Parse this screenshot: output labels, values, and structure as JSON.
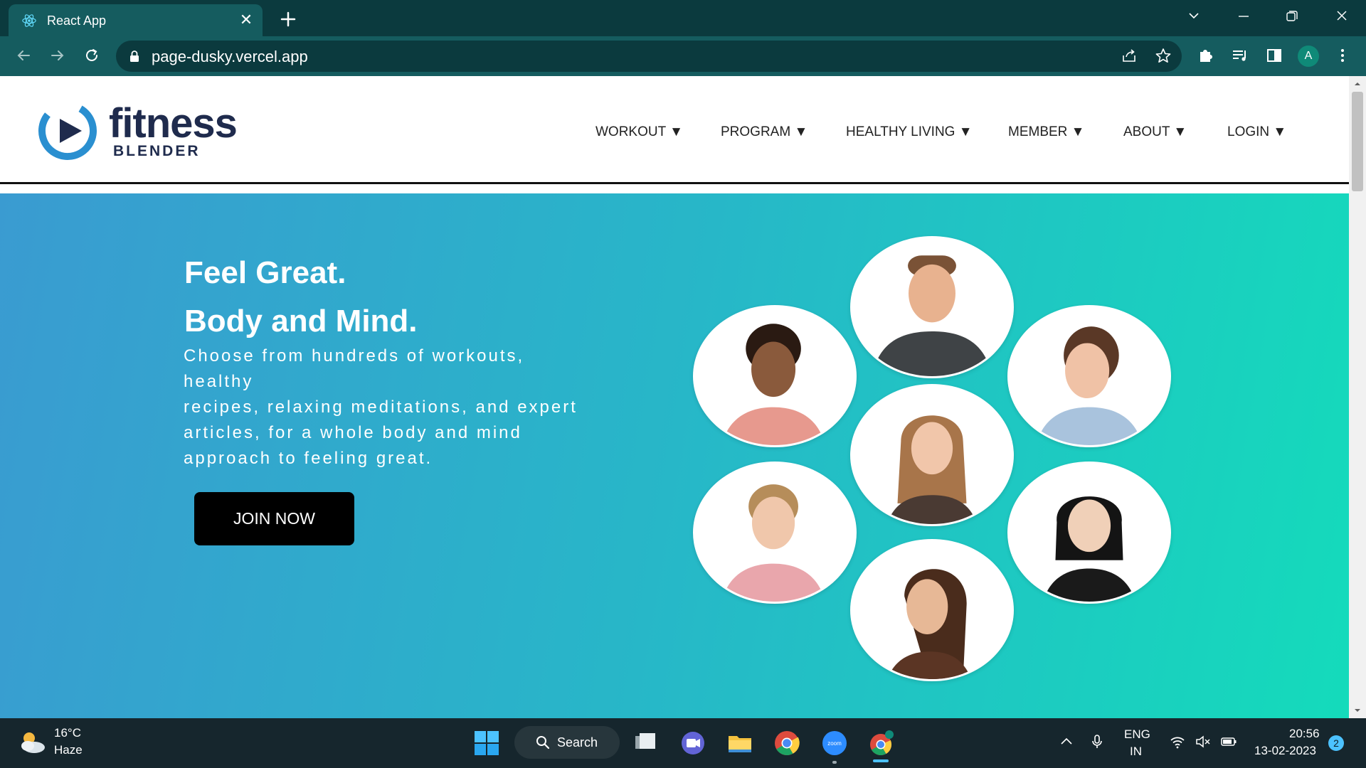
{
  "browser": {
    "tab_title": "React App",
    "url": "page-dusky.vercel.app",
    "profile_initial": "A"
  },
  "site": {
    "logo_word": "fitness",
    "logo_sub": "BLENDER",
    "nav": [
      "WORKOUT ▼",
      "PROGRAM ▼",
      "HEALTHY LIVING ▼",
      "MEMBER ▼",
      "ABOUT ▼",
      "LOGIN ▼"
    ],
    "headline": [
      "Feel Great.",
      "Body and Mind."
    ],
    "description": [
      "Choose from hundreds of workouts,",
      "healthy",
      "recipes, relaxing meditations, and expert",
      "articles, for a whole body and mind",
      "approach to feeling great."
    ],
    "cta": "JOIN NOW",
    "portrait_icons": [
      "person-icon",
      "person-icon",
      "person-icon",
      "person-icon",
      "person-icon",
      "person-icon",
      "person-icon"
    ]
  },
  "taskbar": {
    "weather_temp": "16°C",
    "weather_condition": "Haze",
    "search_label": "Search",
    "lang_line1": "ENG",
    "lang_line2": "IN",
    "time": "20:56",
    "date": "13-02-2023",
    "notification_count": "2"
  },
  "colors": {
    "chrome_dark": "#0b3a3e",
    "chrome_toolbar": "#155c5f",
    "hero_start": "#3a9bd1",
    "hero_end": "#14dbbb",
    "brand_navy": "#1f2b4d",
    "brand_blue": "#2a8fd0"
  }
}
